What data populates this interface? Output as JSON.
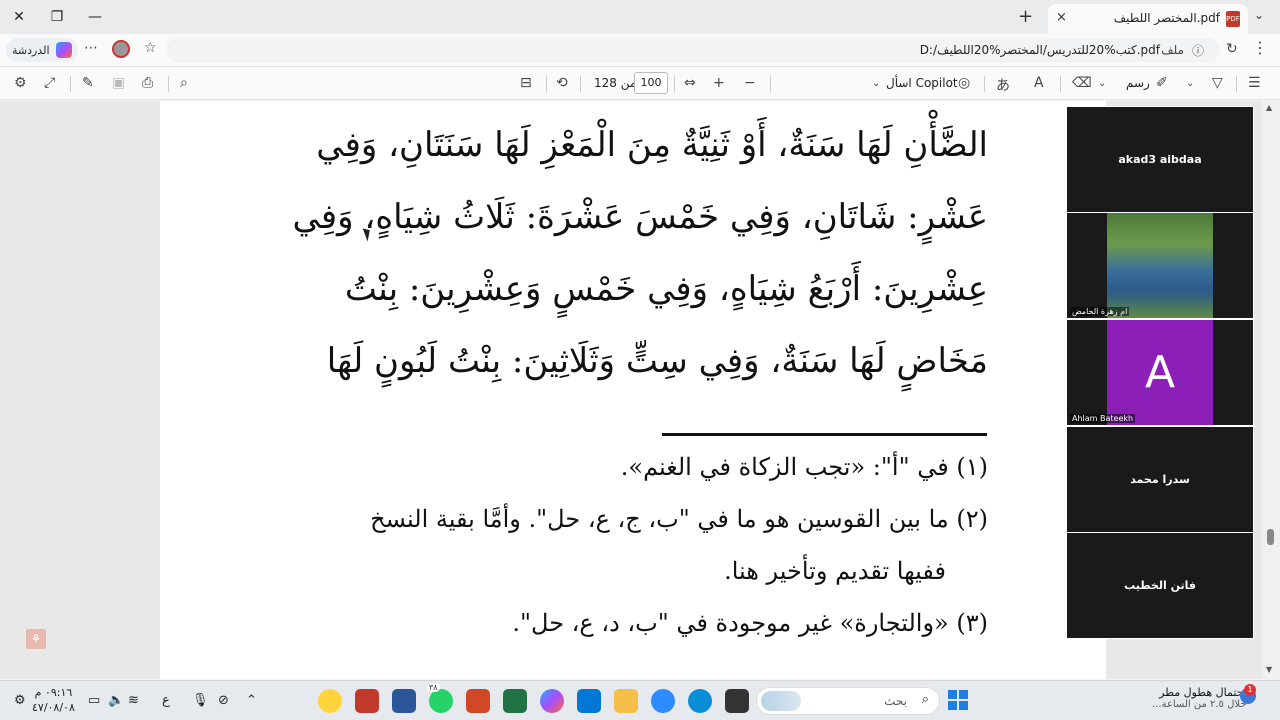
{
  "browser": {
    "tab_title": "المختصر اللطيف.pdf",
    "url": "D:/كتب%20للتدريس/المختصر%20اللطيف.pdf",
    "url_label": "ملف",
    "chat_label": "الدردشة",
    "new_tab": "+",
    "close_tab": "×"
  },
  "pdf_toolbar": {
    "page_current": "100",
    "page_of": "من 128",
    "ask_copilot": "اسأل Copilot",
    "draw": "رسم"
  },
  "document": {
    "body_lines": [
      "الضَّأْنِ لَهَا سَنَةٌ، أَوْ ثَنِيَّةٌ مِنَ الْمَعْزِ لَهَا سَنَتَانِ، وَفِي",
      "عَشْرٍ: شَاتَانِ، وَفِي خَمْسَ عَشْرَةَ: ثَلَاثُ شِيَاهٍ، وَفِي",
      "عِشْرِينَ: أَرْبَعُ شِيَاهٍ، وَفِي خَمْسٍ وَعِشْرِينَ: بِنْتُ",
      "مَخَاضٍ لَهَا سَنَةٌ، وَفِي سِتٍّ وَثَلَاثِينَ: بِنْتُ لَبُونٍ لَهَا"
    ],
    "footnotes": [
      "(١) في \"أ\": «تجب الزكاة في الغنم».",
      "(٢) ما بين القوسين هو ما في \"ب، ج، ع، حل\". وأمَّا بقية النسخ",
      "ففيها تقديم وتأخير هنا.",
      "(٣) «والتجارة» غير موجودة في \"ب، د، ع، حل\"."
    ]
  },
  "video_panel": {
    "participants": [
      {
        "name": "akad3 aibdaa",
        "type": "name"
      },
      {
        "name": "ام زهرة الحامض",
        "type": "image"
      },
      {
        "name": "Ahlam Bateekh",
        "type": "avatar",
        "initial": "A"
      },
      {
        "name": "سدرا محمد",
        "type": "name"
      },
      {
        "name": "فاتن الخطيب",
        "type": "name"
      }
    ]
  },
  "taskbar": {
    "time": "٠٩:١٦ م",
    "date": "٤٧/٠٨/٠٨",
    "lang": "ع",
    "search_placeholder": "بحث",
    "weather_title": "احتمال هطول مطر",
    "weather_sub": "خلال ٢.٥ من الساعة...",
    "weather_badge": "1",
    "whatsapp_badge": "٣٨"
  },
  "colors": {
    "accent": "#1f7fe0",
    "avatar_purple": "#8b1fb8",
    "pdf_red": "#c0392b"
  }
}
